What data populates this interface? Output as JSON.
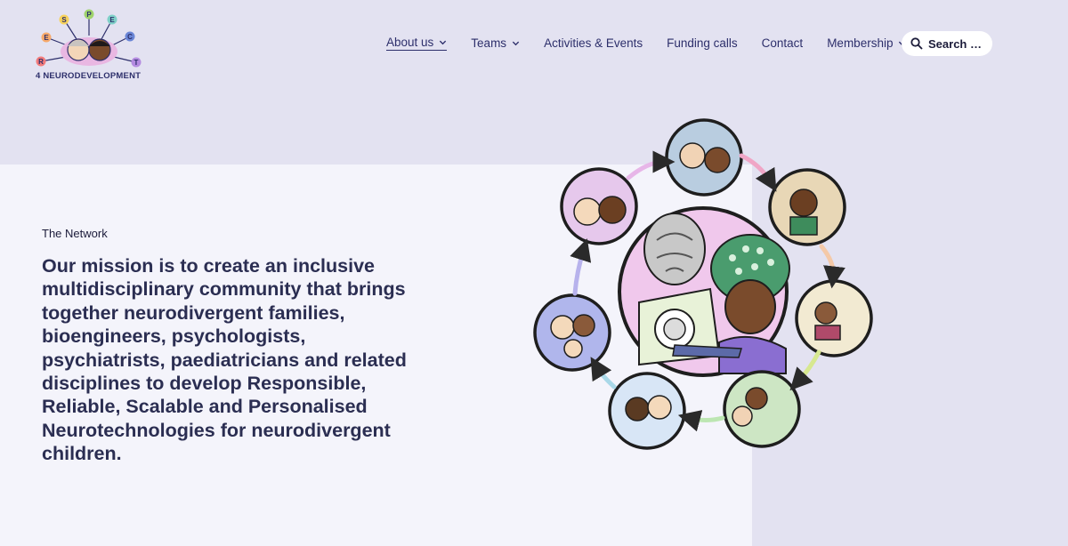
{
  "brand": {
    "logo_letters": [
      "E",
      "S",
      "P",
      "E",
      "C",
      "R",
      "T"
    ],
    "logo_text": "4 NEURODEVELOPMENT"
  },
  "nav": {
    "items": [
      {
        "label": "About us",
        "has_dropdown": true,
        "active": true
      },
      {
        "label": "Teams",
        "has_dropdown": true,
        "active": false
      },
      {
        "label": "Activities & Events",
        "has_dropdown": false,
        "active": false
      },
      {
        "label": "Funding calls",
        "has_dropdown": false,
        "active": false
      },
      {
        "label": "Contact",
        "has_dropdown": false,
        "active": false
      },
      {
        "label": "Membership",
        "has_dropdown": true,
        "active": false
      }
    ],
    "search_placeholder": "Search …"
  },
  "hero": {
    "eyebrow": "The Network",
    "mission": "Our mission is to create an inclusive multidisciplinary community that brings together neurodivergent families, bioengineers, psychologists, psychiatrists, paediatricians and related disciplines to develop Responsible, Reliable, Scalable and Personalised Neurotechnologies for neurodivergent children."
  },
  "colors": {
    "page_bg": "#e3e2f1",
    "panel_bg": "#f4f4fb",
    "text_dark": "#2b2e52",
    "nav_text": "#2d2f6b"
  },
  "icons": [
    "search-icon",
    "chevron-down-icon"
  ]
}
